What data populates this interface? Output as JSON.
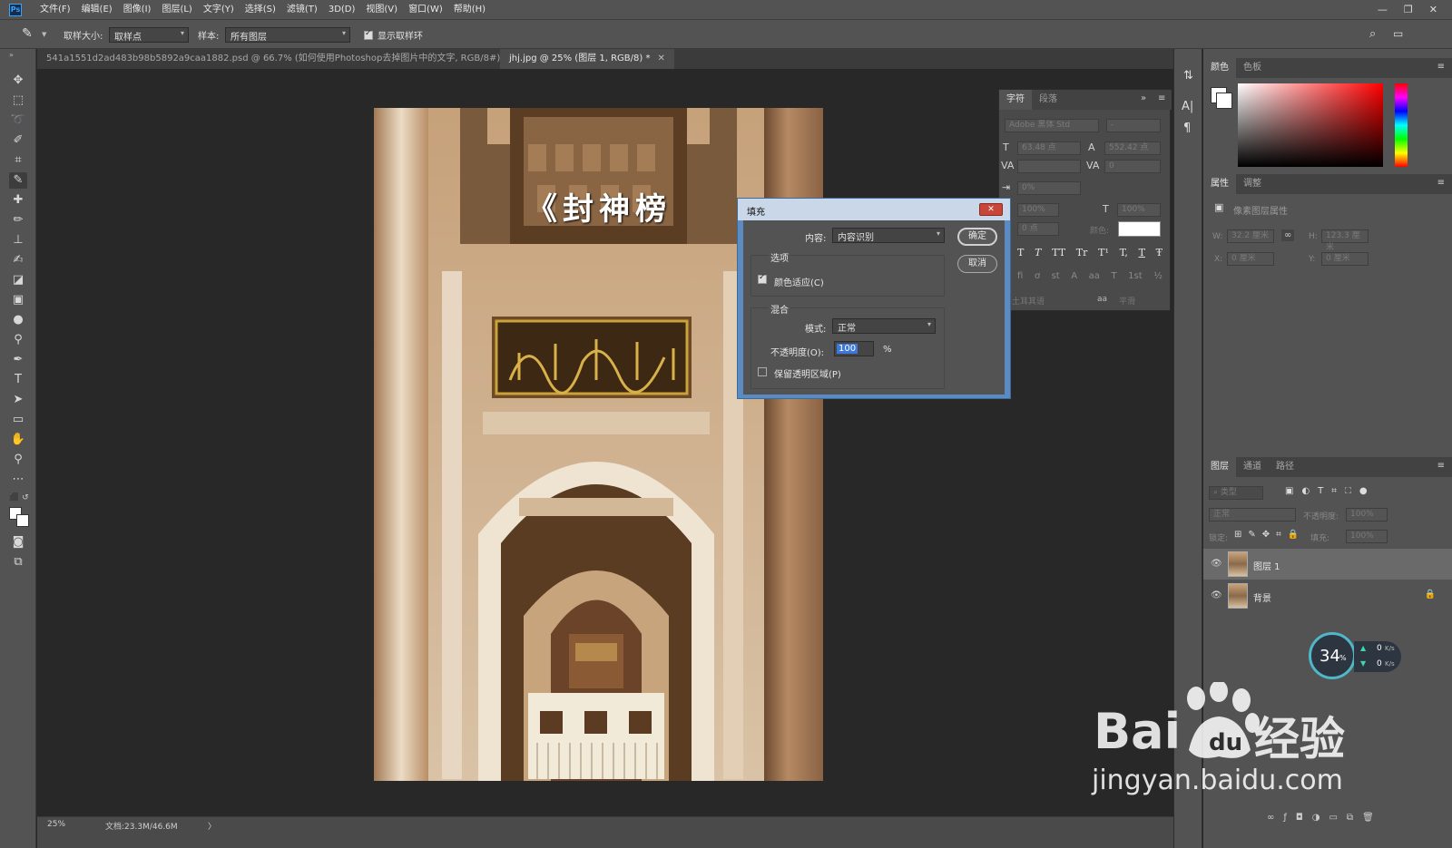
{
  "menubar": {
    "logo": "Ps",
    "items": [
      "文件(F)",
      "编辑(E)",
      "图像(I)",
      "图层(L)",
      "文字(Y)",
      "选择(S)",
      "滤镜(T)",
      "3D(D)",
      "视图(V)",
      "窗口(W)",
      "帮助(H)"
    ]
  },
  "options": {
    "sample_size_label": "取样大小:",
    "sample_size_value": "取样点",
    "sample_label": "样本:",
    "sample_value": "所有图层",
    "show_ring_label": "显示取样环",
    "show_ring_checked": true
  },
  "tabs": [
    {
      "label": "541a1551d2ad483b98b5892a9caa1882.psd @ 66.7% (如何使用Photoshop去掉图片中的文字, RGB/8#) *",
      "active": false
    },
    {
      "label": "jhj.jpg @ 25% (图层 1, RGB/8) *",
      "active": true
    }
  ],
  "photo": {
    "overlay_text": "《封神榜",
    "colors": {
      "stone_light": "#e8d6bf",
      "stone_mid": "#c49a6c",
      "stone_dark": "#6e4a2a",
      "gold": "#c9a23a"
    }
  },
  "statusbar": {
    "zoom": "25%",
    "doc_info": "文档:23.3M/46.6M",
    "arrow": "〉"
  },
  "char_panel": {
    "tabs": [
      "字符",
      "段落"
    ],
    "font_family": "Adobe 黑体 Std",
    "font_style": "-",
    "font_size": "63.48 点",
    "leading": "552.42 点",
    "kerning": "",
    "tracking": "0",
    "tsume": "0%",
    "vscale": "100%",
    "hscale": "100%",
    "baseline": "0 点",
    "color_label": "颜色:",
    "language": "土耳其语",
    "aa_label": "aa",
    "antialias": "平滑",
    "style_buttons": [
      "T",
      "T",
      "TT",
      "Tr",
      "T¹",
      "T,",
      "T",
      "Ŧ"
    ],
    "ot_buttons": [
      "fi",
      "ơ",
      "st",
      "A",
      "aa",
      "T",
      "1st",
      "½"
    ]
  },
  "dialog": {
    "title": "填充",
    "content_label": "内容:",
    "content_value": "内容识别",
    "options_group": "选项",
    "color_adapt_label": "颜色适应(C)",
    "color_adapt_checked": true,
    "blend_group": "混合",
    "mode_label": "模式:",
    "mode_value": "正常",
    "opacity_label": "不透明度(O):",
    "opacity_value": "100",
    "opacity_unit": "%",
    "preserve_label": "保留透明区域(P)",
    "preserve_checked": false,
    "ok_label": "确定",
    "cancel_label": "取消",
    "close_glyph": "✕"
  },
  "color_panel": {
    "tabs": [
      "颜色",
      "色板"
    ]
  },
  "properties_panel": {
    "tabs": [
      "属性",
      "调整"
    ],
    "title": "像素图层属性",
    "w_label": "W:",
    "w_value": "32.2 厘米",
    "h_label": "H:",
    "h_value": "123.3 厘米",
    "x_label": "X:",
    "x_value": "0 厘米",
    "y_label": "Y:",
    "y_value": "0 厘米"
  },
  "layers_panel": {
    "tabs": [
      "图层",
      "通道",
      "路径"
    ],
    "filter_label": "类型",
    "blend_mode": "正常",
    "opacity_label": "不透明度:",
    "opacity_value": "100%",
    "lock_label": "锁定:",
    "fill_label": "填充:",
    "fill_value": "100%",
    "layers": [
      {
        "name": "图层 1",
        "selected": true,
        "locked": false
      },
      {
        "name": "背景",
        "selected": false,
        "locked": true
      }
    ]
  },
  "net_widget": {
    "percent": "34",
    "percent_unit": "%",
    "up": "0",
    "down": "0",
    "unit": "K/s"
  },
  "watermark": {
    "brand_left": "Bai",
    "brand_right": "经验",
    "url": "jingyan.baidu.com"
  }
}
